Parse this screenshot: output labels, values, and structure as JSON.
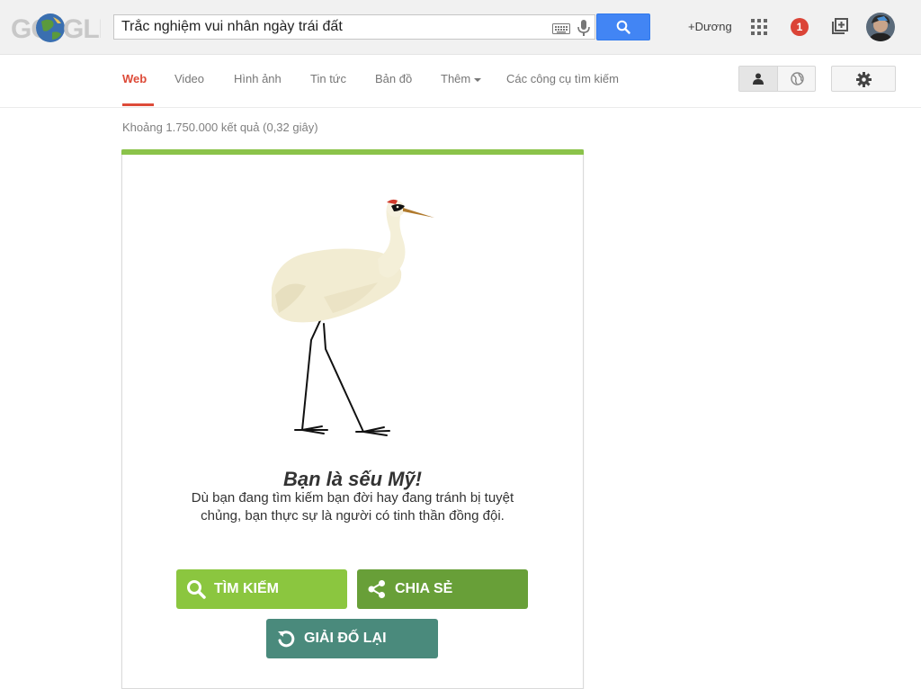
{
  "header": {
    "logo_text": "GOOGLE",
    "search": {
      "value": "Trắc nghiệm vui nhân ngày trái đất",
      "placeholder": ""
    },
    "keyboard_icon": "keyboard-icon",
    "mic_icon": "microphone-icon",
    "search_icon": "search-icon",
    "user_link": "+Dương",
    "apps_icon": "apps-grid-icon",
    "notification_count": "1",
    "share_icon": "plus-box-icon",
    "avatar_icon": "avatar"
  },
  "nav": {
    "tabs": [
      {
        "label": "Web",
        "active": true
      },
      {
        "label": "Video"
      },
      {
        "label": "Hình ảnh"
      },
      {
        "label": "Tin tức"
      },
      {
        "label": "Bản đồ"
      },
      {
        "label": "Thêm"
      },
      {
        "label": "Các công cụ tìm kiếm"
      }
    ],
    "personal_icon": "person-icon",
    "global_icon": "globe-icon",
    "settings_icon": "gear-icon"
  },
  "results": {
    "stats": "Khoảng 1.750.000 kết quả (0,32 giây)"
  },
  "quiz": {
    "image": "crane-illustration",
    "title": "Bạn là sếu Mỹ!",
    "description": "Dù bạn đang tìm kiếm bạn đời hay đang tránh bị tuyệt chủng, bạn thực sự là người có tinh thần đồng đội.",
    "buttons": {
      "search": "TÌM KIẾM",
      "share": "CHIA SẺ",
      "retry": "GIẢI ĐỐ LẠI"
    }
  },
  "colors": {
    "accent_red": "#dd4b39",
    "search_blue": "#4285f4",
    "card_green": "#8bc34a",
    "btn_search": "#8bc63f",
    "btn_share": "#689f38",
    "btn_retry": "#4a8a7c"
  }
}
